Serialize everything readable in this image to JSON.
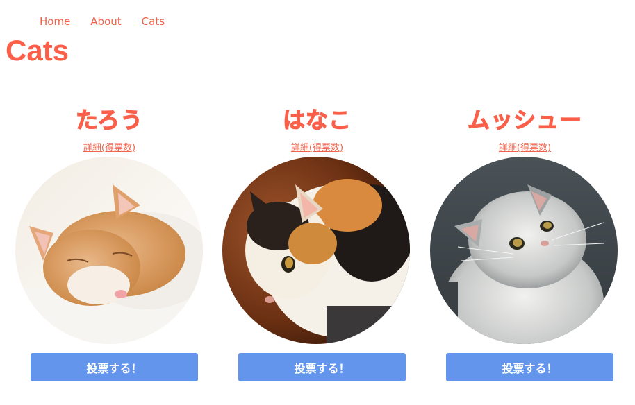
{
  "nav": {
    "items": [
      {
        "label": "Home"
      },
      {
        "label": "About"
      },
      {
        "label": "Cats"
      }
    ]
  },
  "page": {
    "title": "Cats"
  },
  "cats": [
    {
      "name": "たろう",
      "detail_label": "詳細(得票数)",
      "vote_label": "投票する！"
    },
    {
      "name": "はなこ",
      "detail_label": "詳細(得票数)",
      "vote_label": "投票する！"
    },
    {
      "name": "ムッシュー",
      "detail_label": "詳細(得票数)",
      "vote_label": "投票する！"
    }
  ],
  "colors": {
    "accent": "#fa5f49",
    "button": "#6495ed"
  }
}
